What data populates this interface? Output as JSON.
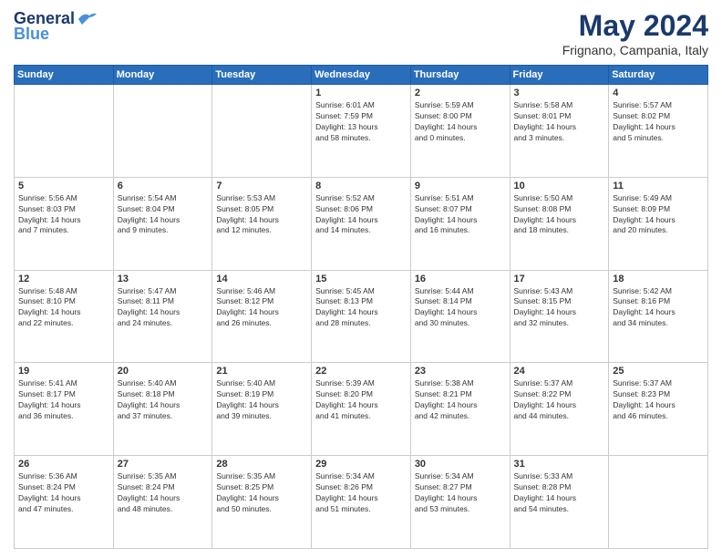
{
  "header": {
    "logo_line1": "General",
    "logo_line2": "Blue",
    "title": "May 2024",
    "subtitle": "Frignano, Campania, Italy"
  },
  "calendar": {
    "days_of_week": [
      "Sunday",
      "Monday",
      "Tuesday",
      "Wednesday",
      "Thursday",
      "Friday",
      "Saturday"
    ],
    "weeks": [
      [
        {
          "day": "",
          "info": ""
        },
        {
          "day": "",
          "info": ""
        },
        {
          "day": "",
          "info": ""
        },
        {
          "day": "1",
          "info": "Sunrise: 6:01 AM\nSunset: 7:59 PM\nDaylight: 13 hours\nand 58 minutes."
        },
        {
          "day": "2",
          "info": "Sunrise: 5:59 AM\nSunset: 8:00 PM\nDaylight: 14 hours\nand 0 minutes."
        },
        {
          "day": "3",
          "info": "Sunrise: 5:58 AM\nSunset: 8:01 PM\nDaylight: 14 hours\nand 3 minutes."
        },
        {
          "day": "4",
          "info": "Sunrise: 5:57 AM\nSunset: 8:02 PM\nDaylight: 14 hours\nand 5 minutes."
        }
      ],
      [
        {
          "day": "5",
          "info": "Sunrise: 5:56 AM\nSunset: 8:03 PM\nDaylight: 14 hours\nand 7 minutes."
        },
        {
          "day": "6",
          "info": "Sunrise: 5:54 AM\nSunset: 8:04 PM\nDaylight: 14 hours\nand 9 minutes."
        },
        {
          "day": "7",
          "info": "Sunrise: 5:53 AM\nSunset: 8:05 PM\nDaylight: 14 hours\nand 12 minutes."
        },
        {
          "day": "8",
          "info": "Sunrise: 5:52 AM\nSunset: 8:06 PM\nDaylight: 14 hours\nand 14 minutes."
        },
        {
          "day": "9",
          "info": "Sunrise: 5:51 AM\nSunset: 8:07 PM\nDaylight: 14 hours\nand 16 minutes."
        },
        {
          "day": "10",
          "info": "Sunrise: 5:50 AM\nSunset: 8:08 PM\nDaylight: 14 hours\nand 18 minutes."
        },
        {
          "day": "11",
          "info": "Sunrise: 5:49 AM\nSunset: 8:09 PM\nDaylight: 14 hours\nand 20 minutes."
        }
      ],
      [
        {
          "day": "12",
          "info": "Sunrise: 5:48 AM\nSunset: 8:10 PM\nDaylight: 14 hours\nand 22 minutes."
        },
        {
          "day": "13",
          "info": "Sunrise: 5:47 AM\nSunset: 8:11 PM\nDaylight: 14 hours\nand 24 minutes."
        },
        {
          "day": "14",
          "info": "Sunrise: 5:46 AM\nSunset: 8:12 PM\nDaylight: 14 hours\nand 26 minutes."
        },
        {
          "day": "15",
          "info": "Sunrise: 5:45 AM\nSunset: 8:13 PM\nDaylight: 14 hours\nand 28 minutes."
        },
        {
          "day": "16",
          "info": "Sunrise: 5:44 AM\nSunset: 8:14 PM\nDaylight: 14 hours\nand 30 minutes."
        },
        {
          "day": "17",
          "info": "Sunrise: 5:43 AM\nSunset: 8:15 PM\nDaylight: 14 hours\nand 32 minutes."
        },
        {
          "day": "18",
          "info": "Sunrise: 5:42 AM\nSunset: 8:16 PM\nDaylight: 14 hours\nand 34 minutes."
        }
      ],
      [
        {
          "day": "19",
          "info": "Sunrise: 5:41 AM\nSunset: 8:17 PM\nDaylight: 14 hours\nand 36 minutes."
        },
        {
          "day": "20",
          "info": "Sunrise: 5:40 AM\nSunset: 8:18 PM\nDaylight: 14 hours\nand 37 minutes."
        },
        {
          "day": "21",
          "info": "Sunrise: 5:40 AM\nSunset: 8:19 PM\nDaylight: 14 hours\nand 39 minutes."
        },
        {
          "day": "22",
          "info": "Sunrise: 5:39 AM\nSunset: 8:20 PM\nDaylight: 14 hours\nand 41 minutes."
        },
        {
          "day": "23",
          "info": "Sunrise: 5:38 AM\nSunset: 8:21 PM\nDaylight: 14 hours\nand 42 minutes."
        },
        {
          "day": "24",
          "info": "Sunrise: 5:37 AM\nSunset: 8:22 PM\nDaylight: 14 hours\nand 44 minutes."
        },
        {
          "day": "25",
          "info": "Sunrise: 5:37 AM\nSunset: 8:23 PM\nDaylight: 14 hours\nand 46 minutes."
        }
      ],
      [
        {
          "day": "26",
          "info": "Sunrise: 5:36 AM\nSunset: 8:24 PM\nDaylight: 14 hours\nand 47 minutes."
        },
        {
          "day": "27",
          "info": "Sunrise: 5:35 AM\nSunset: 8:24 PM\nDaylight: 14 hours\nand 48 minutes."
        },
        {
          "day": "28",
          "info": "Sunrise: 5:35 AM\nSunset: 8:25 PM\nDaylight: 14 hours\nand 50 minutes."
        },
        {
          "day": "29",
          "info": "Sunrise: 5:34 AM\nSunset: 8:26 PM\nDaylight: 14 hours\nand 51 minutes."
        },
        {
          "day": "30",
          "info": "Sunrise: 5:34 AM\nSunset: 8:27 PM\nDaylight: 14 hours\nand 53 minutes."
        },
        {
          "day": "31",
          "info": "Sunrise: 5:33 AM\nSunset: 8:28 PM\nDaylight: 14 hours\nand 54 minutes."
        },
        {
          "day": "",
          "info": ""
        }
      ]
    ]
  }
}
